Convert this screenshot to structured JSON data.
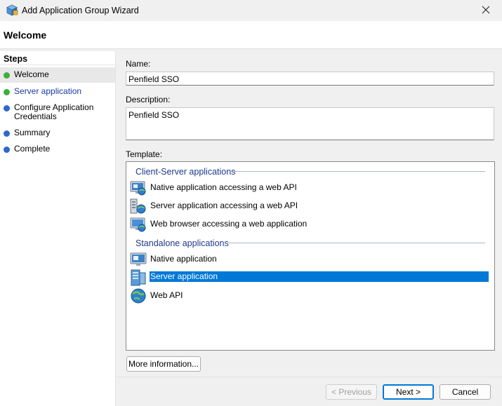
{
  "window": {
    "title": "Add Application Group Wizard",
    "icon": "wizard-app-icon",
    "close_icon": "close-icon"
  },
  "header": {
    "title": "Welcome"
  },
  "steps": {
    "heading": "Steps",
    "items": [
      {
        "label": "Welcome",
        "status_color": "#3cae3c",
        "state": "current"
      },
      {
        "label": "Server application",
        "status_color": "#3cae3c",
        "state": "link"
      },
      {
        "label": "Configure Application Credentials",
        "status_color": "#2f66d0",
        "state": "pending"
      },
      {
        "label": "Summary",
        "status_color": "#2f66d0",
        "state": "pending"
      },
      {
        "label": "Complete",
        "status_color": "#2f66d0",
        "state": "pending"
      }
    ]
  },
  "form": {
    "name_label": "Name:",
    "name_value": "Penfield SSO",
    "description_label": "Description:",
    "description_value": "Penfield SSO",
    "template_label": "Template:"
  },
  "templates": {
    "groups": [
      {
        "header": "Client-Server applications",
        "items": [
          {
            "label": "Native application accessing a web API",
            "icon": "native-app-icon"
          },
          {
            "label": "Server application accessing a web API",
            "icon": "server-app-icon"
          },
          {
            "label": "Web browser accessing a web application",
            "icon": "web-browser-icon"
          }
        ]
      },
      {
        "header": "Standalone applications",
        "items": [
          {
            "label": "Native application",
            "icon": "native-app-icon"
          },
          {
            "label": "Server application",
            "icon": "server-app-icon",
            "selected": true
          },
          {
            "label": "Web API",
            "icon": "globe-icon"
          }
        ]
      }
    ]
  },
  "buttons": {
    "more_info": "More information...",
    "previous": "< Previous",
    "next": "Next >",
    "cancel": "Cancel"
  },
  "colors": {
    "selection": "#0078d7",
    "group_header": "#1e3a8a",
    "link": "#1a3aa6"
  }
}
